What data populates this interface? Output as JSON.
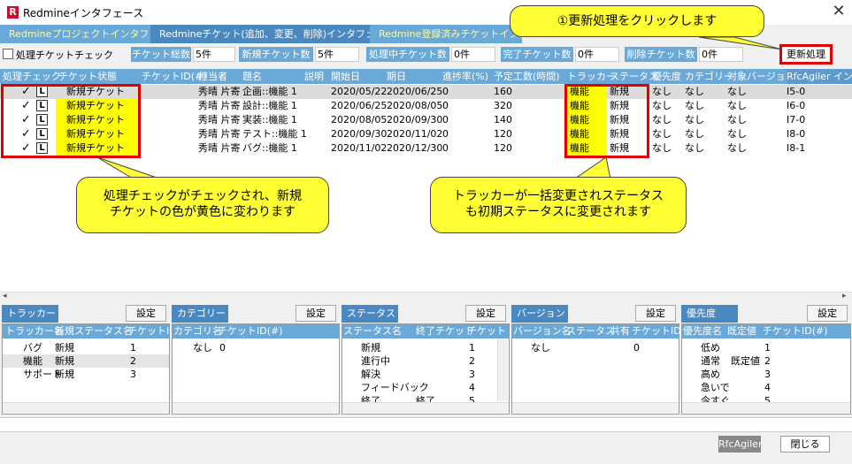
{
  "window": {
    "title": "Redmineインタフェース",
    "icon_letter": "R",
    "close_glyph": "✕"
  },
  "tabs": [
    "Redmineプロジェクトインタフェース",
    "Redmineチケット(追加、変更、削除)インタフェース",
    "Redmine登録済みチケットインタフェース"
  ],
  "summary": {
    "process_check_label": "処理チケットチェック",
    "total_label": "チケット総数",
    "total_value": "5件",
    "new_label": "新規チケット数",
    "new_value": "5件",
    "processing_label": "処理中チケット数",
    "processing_value": "0件",
    "done_label": "完了チケット数",
    "done_value": "0件",
    "deleted_label": "削除チケット数",
    "deleted_value": "0件",
    "update_button": "更新処理"
  },
  "grid": {
    "headers": [
      "処理チェック",
      "チケット状態",
      "チケットID(#)",
      "担当者",
      "題名",
      "説明",
      "開始日",
      "期日",
      "進捗率(%)",
      "予定工数(時間)",
      "トラッカー",
      "ステータス",
      "優先度",
      "カテゴリー",
      "対象バージョン",
      "RfcAgiler インタ"
    ],
    "rows": [
      {
        "check": "✓",
        "lock": "L",
        "state": "新規チケット",
        "assignee": "秀晴 片寄",
        "subject": "企画::機能 1",
        "start": "2020/05/22",
        "due": "2020/06/25",
        "progress": "0",
        "hours": "160",
        "tracker": "機能",
        "status": "新規",
        "priority": "なし",
        "category": "なし",
        "version": "なし",
        "rfc": "I5-0"
      },
      {
        "check": "✓",
        "lock": "L",
        "state": "新規チケット",
        "assignee": "秀晴 片寄",
        "subject": "設計::機能 1",
        "start": "2020/06/25",
        "due": "2020/08/05",
        "progress": "0",
        "hours": "320",
        "tracker": "機能",
        "status": "新規",
        "priority": "なし",
        "category": "なし",
        "version": "なし",
        "rfc": "I6-0"
      },
      {
        "check": "✓",
        "lock": "L",
        "state": "新規チケット",
        "assignee": "秀晴 片寄",
        "subject": "実装::機能 1",
        "start": "2020/08/05",
        "due": "2020/09/30",
        "progress": "0",
        "hours": "140",
        "tracker": "機能",
        "status": "新規",
        "priority": "なし",
        "category": "なし",
        "version": "なし",
        "rfc": "I7-0"
      },
      {
        "check": "✓",
        "lock": "L",
        "state": "新規チケット",
        "assignee": "秀晴 片寄",
        "subject": "テスト::機能 1",
        "start": "2020/09/30",
        "due": "2020/11/02",
        "progress": "0",
        "hours": "120",
        "tracker": "機能",
        "status": "新規",
        "priority": "なし",
        "category": "なし",
        "version": "なし",
        "rfc": "I8-0"
      },
      {
        "check": "✓",
        "lock": "L",
        "state": "新規チケット",
        "assignee": "秀晴 片寄",
        "subject": "バグ::機能 1",
        "start": "2020/11/02",
        "due": "2020/12/30",
        "progress": "0",
        "hours": "120",
        "tracker": "機能",
        "status": "新規",
        "priority": "なし",
        "category": "なし",
        "version": "なし",
        "rfc": "I8-1"
      }
    ]
  },
  "callouts": {
    "top": "①更新処理をクリックします",
    "left": "処理チェックがチェックされ、新規\nチケットの色が黄色に変わります",
    "right": "トラッカーが一括変更されステータス\nも初期ステータスに変更されます"
  },
  "panels": {
    "settings_label": "設定",
    "tracker": {
      "title": "トラッカー",
      "headers": [
        "トラッカー名",
        "新規ステータス名",
        "チケットID("
      ],
      "rows": [
        [
          "バグ",
          "新規",
          "1"
        ],
        [
          "機能",
          "新規",
          "2"
        ],
        [
          "サポート",
          "新規",
          "3"
        ]
      ]
    },
    "category": {
      "title": "カテゴリー",
      "headers": [
        "カテゴリ名",
        "チケットID(#)"
      ],
      "rows": [
        [
          "なし",
          "0"
        ]
      ]
    },
    "status": {
      "title": "ステータス",
      "headers": [
        "ステータス名",
        "終了チケット",
        "チケット"
      ],
      "rows": [
        [
          "新規",
          "",
          "1"
        ],
        [
          "進行中",
          "",
          "2"
        ],
        [
          "解決",
          "",
          "3"
        ],
        [
          "フィードバック",
          "",
          "4"
        ],
        [
          "終了",
          "終了",
          "5"
        ]
      ]
    },
    "version": {
      "title": "バージョン",
      "headers": [
        "バージョン名",
        "ステータス",
        "共有",
        "チケットID(#"
      ],
      "rows": [
        [
          "なし",
          "",
          "",
          "0"
        ]
      ]
    },
    "priority": {
      "title": "優先度",
      "headers": [
        "優先度名",
        "既定値",
        "チケットID(#)"
      ],
      "rows": [
        [
          "低め",
          "",
          "1"
        ],
        [
          "通常",
          "既定値",
          "2"
        ],
        [
          "高め",
          "",
          "3"
        ],
        [
          "急いで",
          "",
          "4"
        ],
        [
          "今すぐ",
          "",
          "5"
        ]
      ]
    }
  },
  "footer": {
    "rfc_button": "RfcAgiler",
    "close_button": "閉じる"
  },
  "colors": {
    "header_blue": "#6aa8d8",
    "tab_active": "#4a88bf",
    "highlight_yellow": "#ffff00",
    "callout_yellow": "#ffff33",
    "annotation_red": "#e00000"
  }
}
